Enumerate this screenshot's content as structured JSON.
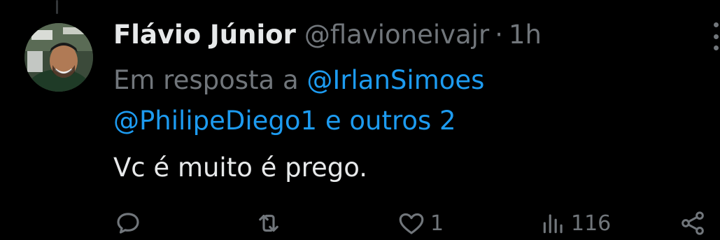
{
  "tweet": {
    "author_name": "Flávio Júnior",
    "handle": "@flavioneivajr",
    "separator": "·",
    "time": "1h",
    "reply_prefix": "Em resposta a",
    "reply_mentions": [
      "@IrlanSimoes",
      "@PhilipeDiego1"
    ],
    "reply_others": "e outros 2",
    "text": "Vc é muito é prego.",
    "stats": {
      "replies": "",
      "retweets": "",
      "likes": "1",
      "views": "116"
    }
  },
  "icons": {
    "reply": "speech-bubble-icon",
    "retweet": "retweet-icon",
    "like": "heart-icon",
    "views": "bar-chart-icon",
    "share": "share-icon",
    "more": "vertical-ellipsis-icon"
  },
  "colors": {
    "background": "#000000",
    "primary_text": "#e7e9ea",
    "secondary_text": "#71767b",
    "link": "#1d9bf0"
  }
}
